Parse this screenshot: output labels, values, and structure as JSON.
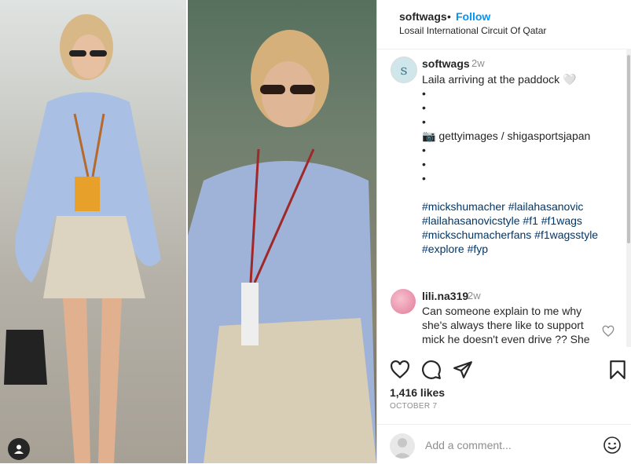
{
  "header": {
    "username": "softwags",
    "separator": "•",
    "follow_label": "Follow",
    "location": "Losail International Circuit Of Qatar"
  },
  "caption": {
    "avatar_letter": "s",
    "username": "softwags",
    "time": "2w",
    "lines": [
      "Laila arriving at the paddock 🤍",
      "•",
      "•",
      "•",
      "📷 gettyimages / shigasportsjapan",
      "•",
      "•",
      "•"
    ],
    "hashtag_lines": [
      "#mickshumacher #lailahasanovic",
      "#lailahasanovicstyle #f1 #f1wags",
      "#mickschumacherfans #f1wagsstyle",
      "#explore #fyp"
    ]
  },
  "comment": {
    "username": "lili.na319",
    "time": "2w",
    "text": "Can someone explain to me why she's always there like to support mick he doesn't even drive ?? She"
  },
  "stats": {
    "likes": "1,416 likes",
    "date": "OCTOBER 7"
  },
  "composer": {
    "placeholder": "Add a comment..."
  },
  "icons": {
    "like": "heart-icon",
    "comment": "comment-bubble-icon",
    "share": "paper-plane-icon",
    "save": "bookmark-icon",
    "emoji": "emoji-icon",
    "user": "user-icon"
  }
}
